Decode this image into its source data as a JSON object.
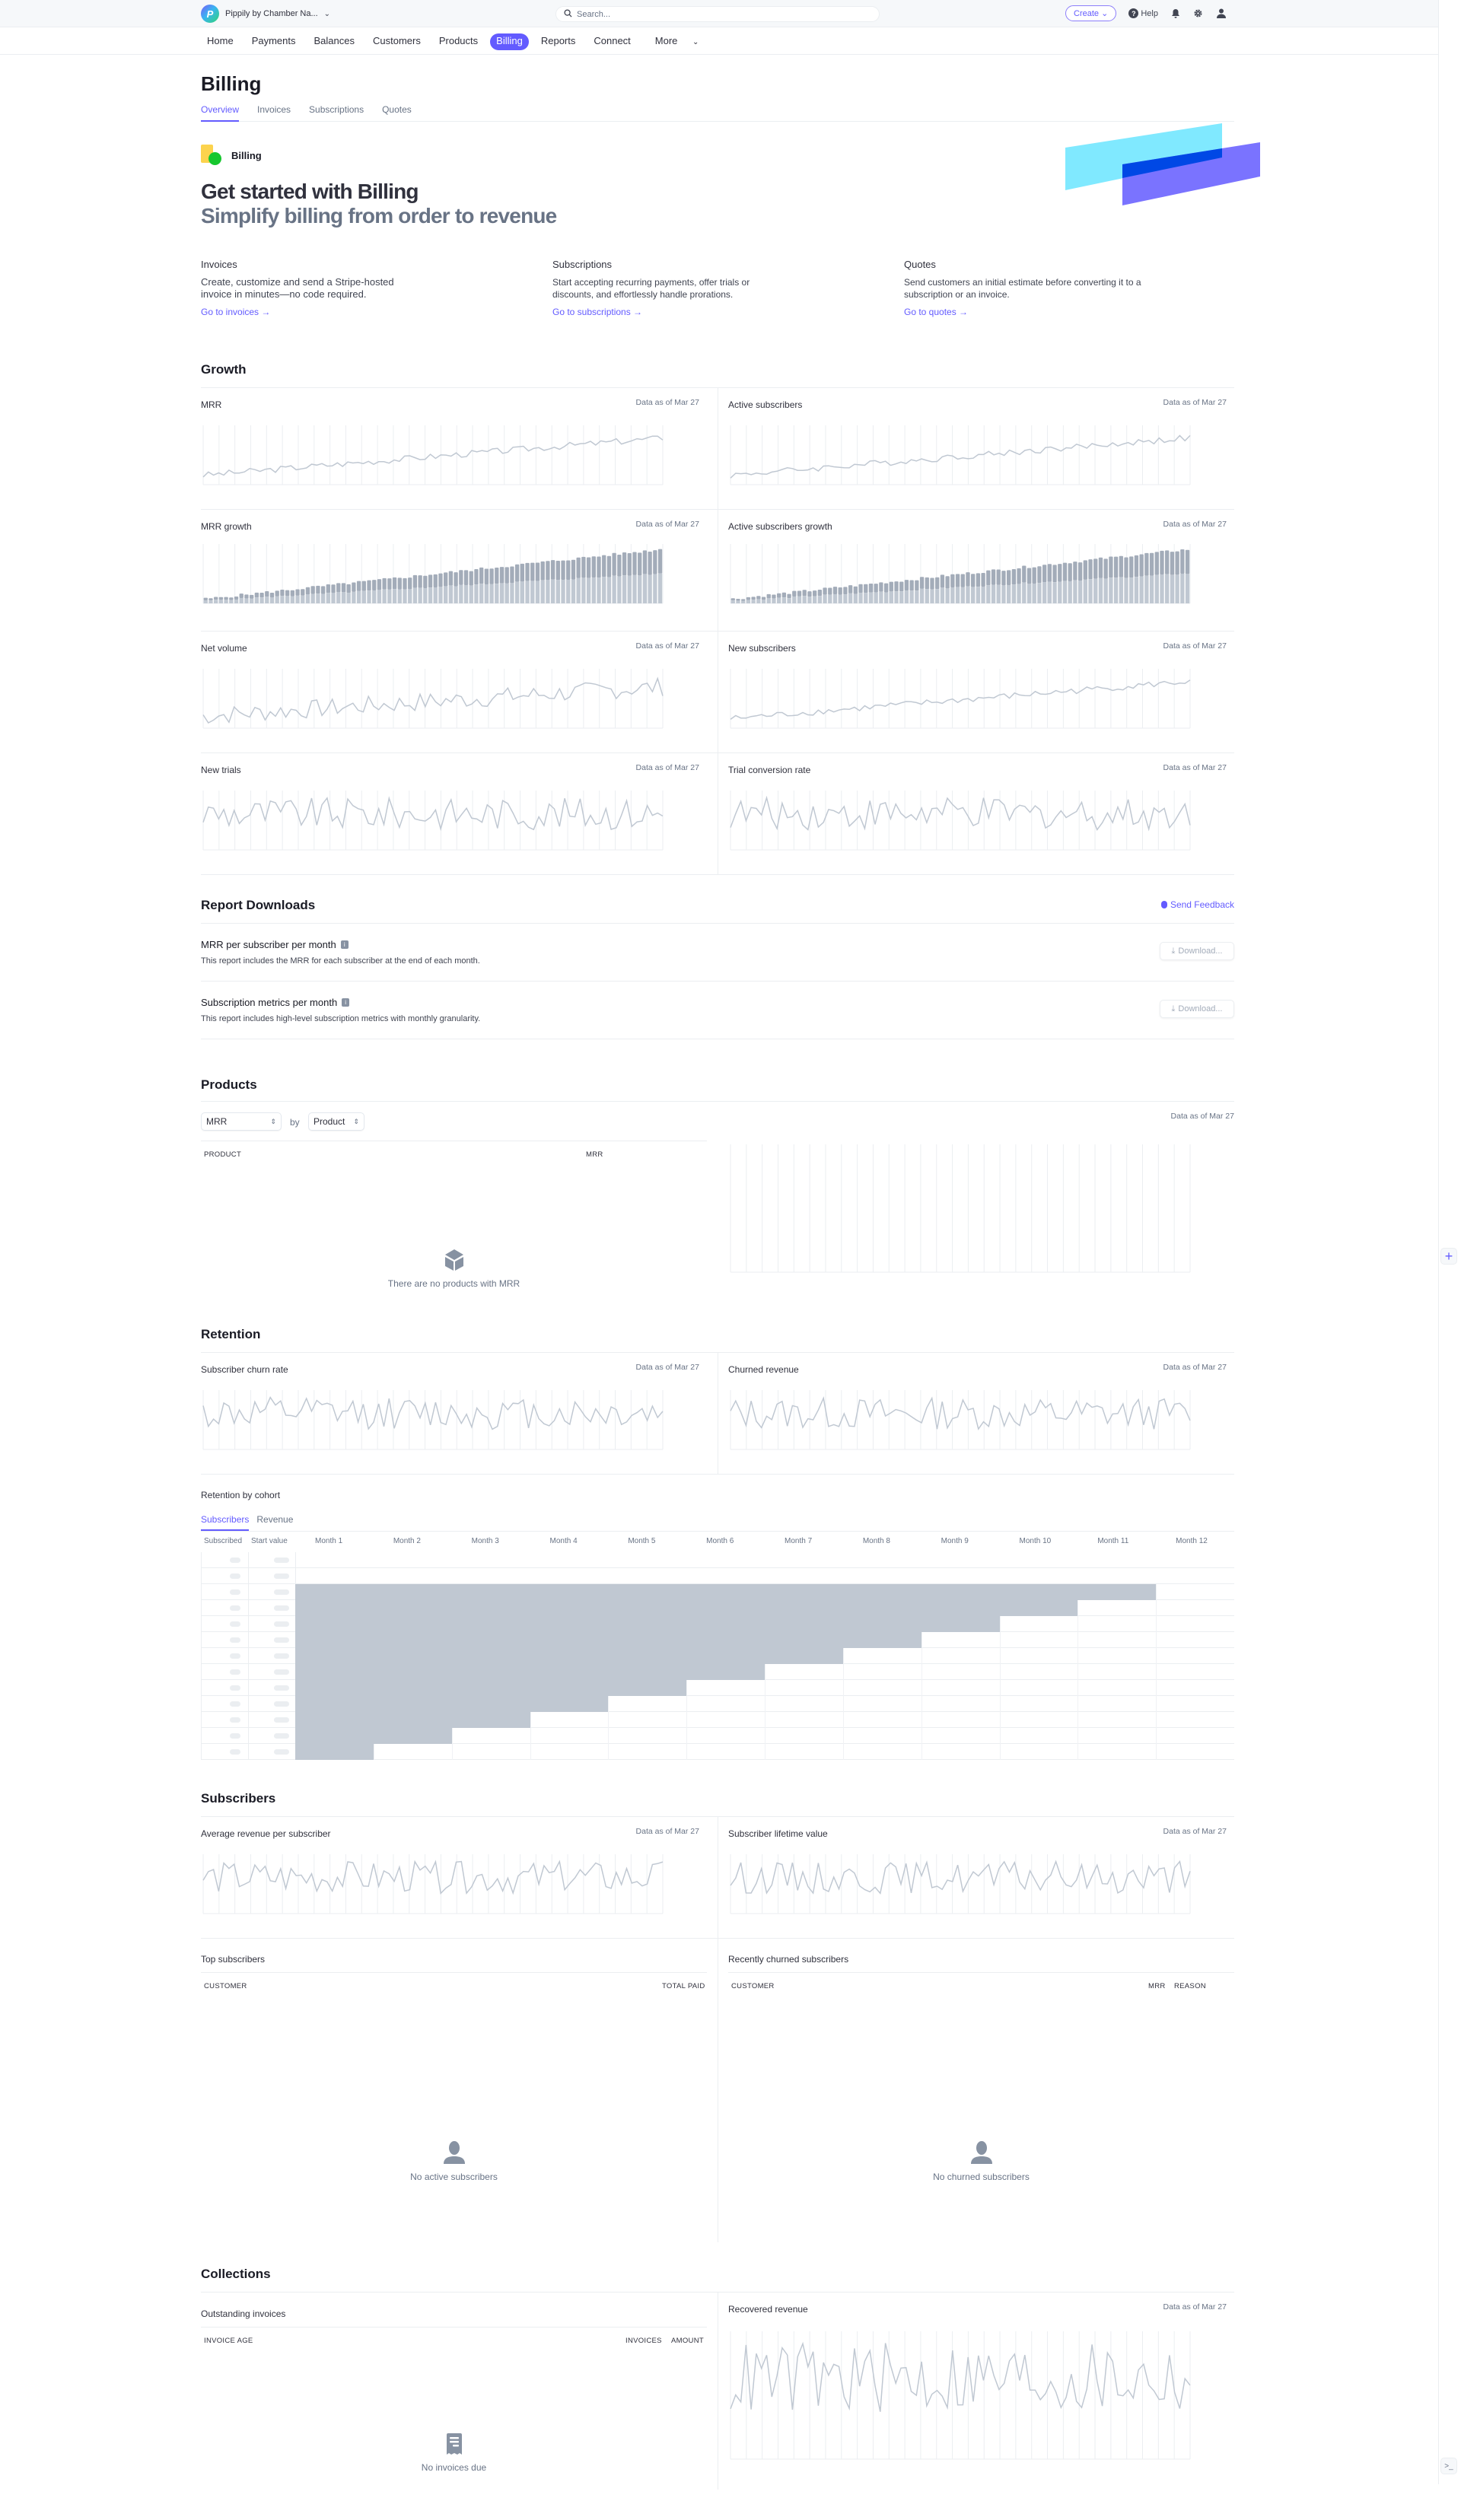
{
  "topbar": {
    "account_name": "Pippily by Chamber Na...",
    "account_initial": "P",
    "search_placeholder": "Search...",
    "create_label": "Create",
    "help_label": "Help"
  },
  "nav": {
    "items": [
      "Home",
      "Payments",
      "Balances",
      "Customers",
      "Products",
      "Billing",
      "Reports",
      "Connect",
      "More"
    ],
    "active": "Billing"
  },
  "page": {
    "title": "Billing",
    "tabs": [
      "Overview",
      "Invoices",
      "Subscriptions",
      "Quotes"
    ],
    "active_tab": "Overview"
  },
  "hero": {
    "badge": "Billing",
    "headline": "Get started with Billing",
    "subheadline": "Simplify billing from order to revenue",
    "features": [
      {
        "title": "Invoices",
        "description": "Create, customize and send a Stripe-hosted invoice in minutes—no code required.",
        "link": "Go to invoices →"
      },
      {
        "title": "Subscriptions",
        "description": "Start accepting recurring payments, offer trials or discounts, and effortlessly handle prorations.",
        "link": "Go to subscriptions →"
      },
      {
        "title": "Quotes",
        "description": "Send customers an initial estimate before converting it to a subscription or an invoice.",
        "link": "Go to quotes →"
      }
    ]
  },
  "colors": {
    "accent": "#635bff",
    "chart_line": "#c0c8d2",
    "chart_bar_dark": "#a3acb9",
    "chart_bar_light": "#c0c8d2",
    "cohort_fill": "#c0c8d2",
    "hero_cyan": "#80e9ff",
    "hero_indigo": "#7a73ff",
    "hero_overlap": "#0048e5"
  },
  "growth": {
    "title": "Growth",
    "data_as_of": "Data as of Mar 27",
    "cards": [
      "MRR",
      "Active subscribers",
      "MRR growth",
      "Active subscribers growth",
      "Net volume",
      "New subscribers",
      "New trials",
      "Trial conversion rate"
    ]
  },
  "reports": {
    "title": "Report Downloads",
    "feedback_label": "Send Feedback",
    "download_label": "Download...",
    "items": [
      {
        "title": "MRR per subscriber per month",
        "description": "This report includes the MRR for each subscriber at the end of each month."
      },
      {
        "title": "Subscription metrics per month",
        "description": "This report includes high-level subscription metrics with monthly granularity."
      }
    ]
  },
  "products": {
    "title": "Products",
    "metric_select": "MRR",
    "by_label": "by",
    "group_select": "Product",
    "col_product": "PRODUCT",
    "col_mrr": "MRR",
    "empty_text": "There are no products with MRR",
    "data_as_of": "Data as of Mar 27"
  },
  "retention": {
    "title": "Retention",
    "cards": [
      "Subscriber churn rate",
      "Churned revenue"
    ],
    "data_as_of": "Data as of Mar 27",
    "cohort_title": "Retention by cohort",
    "cohort_tabs": [
      "Subscribers",
      "Revenue"
    ],
    "cohort_active": "Subscribers",
    "cohort_columns": [
      "Subscribed",
      "Start value",
      "Month 1",
      "Month 2",
      "Month 3",
      "Month 4",
      "Month 5",
      "Month 6",
      "Month 7",
      "Month 8",
      "Month 9",
      "Month 10",
      "Month 11",
      "Month 12"
    ],
    "cohort_rows": 13
  },
  "subscribers": {
    "title": "Subscribers",
    "cards": [
      "Average revenue per subscriber",
      "Subscriber lifetime value"
    ],
    "data_as_of": "Data as of Mar 27",
    "top_title": "Top subscribers",
    "top_cols": [
      "CUSTOMER",
      "TOTAL PAID"
    ],
    "top_empty": "No active subscribers",
    "churned_title": "Recently churned subscribers",
    "churned_cols": [
      "CUSTOMER",
      "MRR",
      "REASON"
    ],
    "churned_empty": "No churned subscribers"
  },
  "collections": {
    "title": "Collections",
    "outstanding_title": "Outstanding invoices",
    "outstanding_cols": [
      "INVOICE AGE",
      "INVOICES",
      "AMOUNT"
    ],
    "outstanding_empty": "No invoices due",
    "recovered_title": "Recovered revenue",
    "data_as_of": "Data as of Mar 27"
  },
  "chart_data": [
    {
      "type": "line",
      "title": "MRR",
      "trend": "rising",
      "points": 90,
      "placeholder": true
    },
    {
      "type": "line",
      "title": "Active subscribers",
      "trend": "rising",
      "points": 90,
      "placeholder": true
    },
    {
      "type": "bar",
      "title": "MRR growth",
      "trend": "rising-stacked",
      "points": 90,
      "placeholder": true
    },
    {
      "type": "bar",
      "title": "Active subscribers growth",
      "trend": "rising-stacked",
      "points": 90,
      "placeholder": true
    },
    {
      "type": "line",
      "title": "Net volume",
      "trend": "rising-noisy",
      "points": 90,
      "placeholder": true
    },
    {
      "type": "line",
      "title": "New subscribers",
      "trend": "rising",
      "points": 90,
      "placeholder": true
    },
    {
      "type": "line",
      "title": "New trials",
      "trend": "flat-noisy",
      "points": 90,
      "placeholder": true
    },
    {
      "type": "line",
      "title": "Trial conversion rate",
      "trend": "flat-noisy",
      "points": 90,
      "placeholder": true
    },
    {
      "type": "line",
      "title": "Products MRR",
      "trend": "empty",
      "points": 0,
      "placeholder": true
    },
    {
      "type": "line",
      "title": "Subscriber churn rate",
      "trend": "flat-noisy",
      "points": 90,
      "placeholder": true
    },
    {
      "type": "line",
      "title": "Churned revenue",
      "trend": "flat-noisy",
      "points": 90,
      "placeholder": true
    },
    {
      "type": "line",
      "title": "Average revenue per subscriber",
      "trend": "flat-noisy",
      "points": 90,
      "placeholder": true
    },
    {
      "type": "line",
      "title": "Subscriber lifetime value",
      "trend": "flat-noisy",
      "points": 90,
      "placeholder": true
    },
    {
      "type": "line",
      "title": "Recovered revenue",
      "trend": "flat-noisy",
      "points": 90,
      "placeholder": true
    }
  ]
}
